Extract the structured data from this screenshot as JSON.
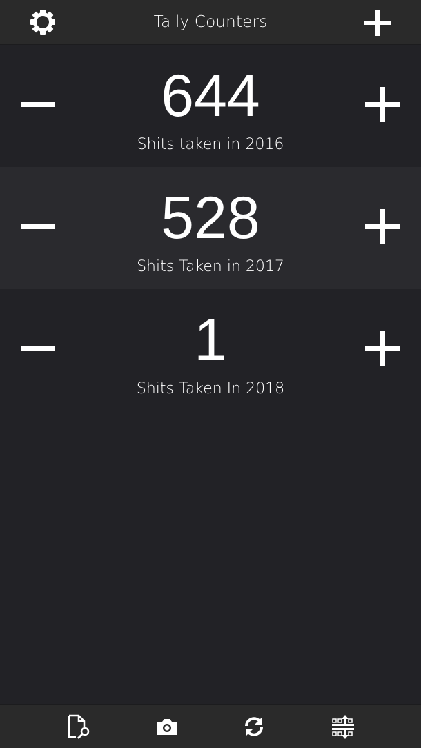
{
  "header": {
    "title": "Tally Counters",
    "settings_icon": "gear-icon",
    "add_icon": "plus-icon"
  },
  "counters": [
    {
      "value": "644",
      "label": "Shits taken in 2016"
    },
    {
      "value": "528",
      "label": "Shits Taken in 2017"
    },
    {
      "value": "1",
      "label": "Shits Taken In 2018"
    }
  ],
  "toolbar": {
    "icons": [
      "document-search-icon",
      "camera-icon",
      "sync-icon",
      "reorder-icon"
    ]
  },
  "colors": {
    "background": "#222226",
    "header": "#2a2a2a",
    "row_alt": "#2a2a2e",
    "text": "#ffffff"
  }
}
